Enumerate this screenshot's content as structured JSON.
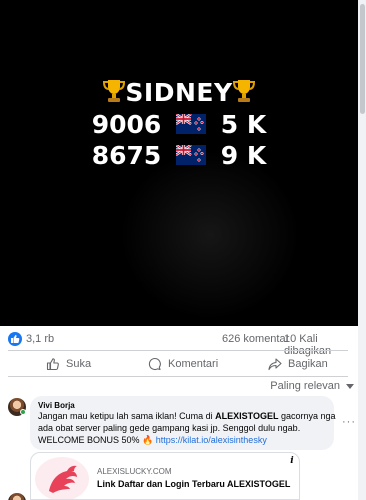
{
  "post": {
    "image": {
      "title": "SIDNEY",
      "line1": {
        "number": "9006",
        "amount": "5 K"
      },
      "line2": {
        "number": "8675",
        "amount": "9 K"
      },
      "icons": [
        "trophy-icon",
        "new-zealand-flag-icon"
      ]
    },
    "stats": {
      "reactions": "3,1 rb",
      "comments": "626 komentar",
      "shares": "10 Kali dibagikan"
    },
    "actions": {
      "like": "Suka",
      "comment": "Komentari",
      "share": "Bagikan"
    }
  },
  "comments": {
    "sort_label": "Paling relevan",
    "items": [
      {
        "author": "Vivi Borja",
        "text_before": "Jangan mau ketipu lah sama iklan! Cuma di ",
        "text_bold": "ALEXISTOGEL",
        "text_after": " gacornya nga ada obat server paling gede gampang kasi jp. Senggol dulu ngab. WELCOME BONUS 50% ",
        "link": "https://kilat.io/alexisinthesky",
        "more": "···"
      }
    ]
  },
  "ad": {
    "domain": "ALEXISLUCKY.COM",
    "title": "Link Daftar dan Login Terbaru ALEXISTOGEL",
    "info_icon": "i"
  },
  "colors": {
    "accent": "#1877f2",
    "link": "#216fdb",
    "muted_text": "#65676b",
    "bubble_bg": "#f0f2f5",
    "online": "#31a24c"
  }
}
